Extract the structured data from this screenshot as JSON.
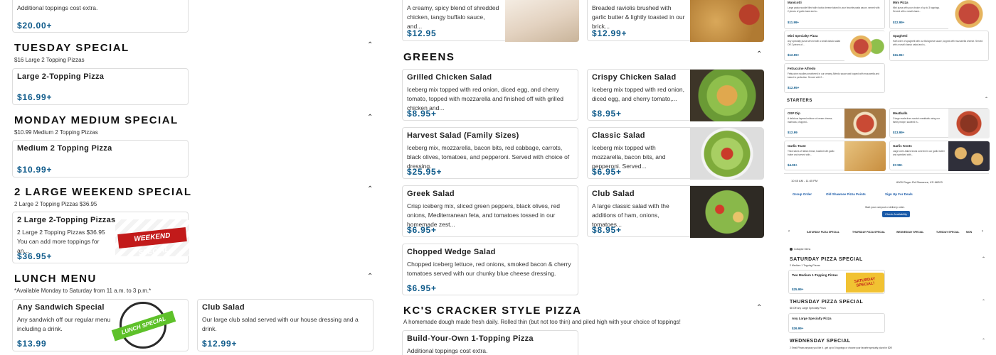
{
  "col1": {
    "top_card": {
      "desc": "Additional toppings cost extra.",
      "price": "$20.00+"
    },
    "tuesday": {
      "title": "TUESDAY SPECIAL",
      "subtitle": "$16 Large 2 Topping Pizzas",
      "item": {
        "name": "Large 2-Topping Pizza",
        "price": "$16.99+"
      }
    },
    "monday": {
      "title": "MONDAY MEDIUM SPECIAL",
      "subtitle": "$10.99 Medium 2 Topping Pizzas",
      "item": {
        "name": "Medium 2 Topping Pizza",
        "price": "$10.99+"
      }
    },
    "weekend": {
      "title": "2 LARGE WEEKEND SPECIAL",
      "subtitle": "2 Large 2 Topping Pizzas $36.95",
      "item": {
        "name": "2 Large 2-Topping Pizzas",
        "desc": "2 Large 2 Topping Pizzas $36.95 You can add more toppings for an...",
        "price": "$36.95+",
        "image_text": "WEEKEND SPECIAL"
      }
    },
    "lunch": {
      "title": "LUNCH MENU",
      "subtitle": "*Available Monday to Saturday from 11 a.m. to 3 p.m.*",
      "sandwich": {
        "name": "Any Sandwich Special",
        "desc": "Any sandwich off our regular menu including a drink.",
        "price": "$13.99",
        "image_text": "LUNCH SPECIAL"
      },
      "club": {
        "name": "Club Salad",
        "desc": "Our large club salad served with our house dressing and a drink.",
        "price": "$12.99+"
      }
    }
  },
  "col2": {
    "top_left": {
      "desc": "A creamy, spicy blend of shredded chicken, tangy buffalo sauce, and...",
      "price": "$12.95"
    },
    "top_right": {
      "desc": "Breaded raviolis brushed with garlic butter & lightly toasted in our brick...",
      "price": "$12.99+"
    },
    "greens_title": "GREENS",
    "salads": [
      {
        "name": "Grilled Chicken Salad",
        "desc": "Iceberg mix topped with red onion, diced egg, and cherry tomato, topped with mozzarella and finished off with grilled chicken and...",
        "price": "$8.95+"
      },
      {
        "name": "Crispy Chicken Salad",
        "desc": "Iceberg mix topped with red onion, diced egg, and cherry tomato,...",
        "price": "$8.95+"
      },
      {
        "name": "Harvest Salad (Family Sizes)",
        "desc": "Iceberg mix, mozzarella, bacon bits, red cabbage, carrots, black olives, tomatoes, and pepperoni. Served with choice of dressing.",
        "price": "$25.95+"
      },
      {
        "name": "Classic Salad",
        "desc": "Iceberg mix topped with mozzarella, bacon bits, and pepperoni. Served...",
        "price": "$6.95+"
      },
      {
        "name": "Greek Salad",
        "desc": "Crisp iceberg mix, sliced green peppers, black olives, red onions, Mediterranean feta, and tomatoes tossed in our homemade zest...",
        "price": "$6.95+"
      },
      {
        "name": "Club Salad",
        "desc": "A large classic salad with the additions of ham, onions, tomatoes...",
        "price": "$8.95+"
      },
      {
        "name": "Chopped Wedge Salad",
        "desc": "Chopped iceberg lettuce, red onions, smoked bacon & cherry tomatoes served with our chunky blue cheese dressing.",
        "price": "$6.95+"
      }
    ],
    "kc": {
      "title": "KC'S CRACKER STYLE PIZZA",
      "subtitle": "A homemade dough made fresh daily. Rolled thin (but not too thin) and piled high with your choice of toppings!",
      "item": {
        "name": "Build-Your-Own 1-Topping Pizza",
        "desc": "Additional toppings cost extra."
      }
    }
  },
  "col3": {
    "top_items": [
      {
        "name": "Manicotti",
        "desc": "Large pasta noodle filled with ricotta cheese baked in your favorite pasta sauce, served with 2 pieces of garlic toast and a...",
        "price": "$11.99+"
      },
      {
        "name": "Mini Pizza",
        "desc": "Mini pizza with your choice of up to 3 toppings. Served with a small classi...",
        "price": "$12.99+"
      },
      {
        "name": "Mini Specialty Pizza",
        "desc": "Any specialty pizza served with a small classic salad OR 2 pieces of...",
        "price": "$12.99+"
      },
      {
        "name": "Spaghetti",
        "desc": "Half order of spaghetti with our Bolognese sauce, topped with mozzarella cheese. Served with a small classic salad and a...",
        "price": "$11.95+"
      },
      {
        "name": "Fettuccine Alfredo",
        "desc": "Fettuccine noodles smothered in our creamy Alfredo sauce and topped with mozzarella and baked to perfection. Served with 2...",
        "price": "$12.95+"
      }
    ],
    "starters_title": "STARTERS",
    "starters": [
      {
        "name": "OSP Dip",
        "desc": "A delicious layered mixture of cream cheese, marinara, chopped...",
        "price": "$12.99"
      },
      {
        "name": "Meatballs",
        "desc": "3 large made-from-scratch meatballs using our family recipe, sautéed in...",
        "price": "$13.99+"
      },
      {
        "name": "Garlic Toast",
        "desc": "Thick slices of Italian bread, toasted with garlic butter and served with...",
        "price": "$4.99+"
      },
      {
        "name": "Garlic Knots",
        "desc": "Large oven-baked knots covered in our garlic butter and sprinkled with...",
        "price": "$7.99+"
      }
    ],
    "hours": "10:45 AM - 11:45 PM",
    "address": "6000 Roger Rd Shawnee, KS 66203",
    "nav": [
      "Group Order",
      "Old Shawnee Pizza Points",
      "Sign Up For Deals"
    ],
    "delivery_prompt": "Start your carryout or delivery order.",
    "check_btn": "Check Availability",
    "tabs": [
      "SATURDAY PIZZA SPECIAL",
      "THURSDAY PIZZA SPECIAL",
      "WEDNESDAY SPECIAL",
      "TUESDAY SPECIAL",
      "MON"
    ],
    "collapse": "Collapse Menu",
    "sat": {
      "title": "SATURDAY PIZZA SPECIAL",
      "sub": "2 Medium 1 Topping Pizzas",
      "item": "Two Medium 1-Topping Pizzas",
      "price": "$25.99+",
      "image_text": "SATURDAY SPECIAL!"
    },
    "thu": {
      "title": "THURSDAY PIZZA SPECIAL",
      "sub": "$8 Off any Large Specialty Pizza",
      "item": "Any Large Specialty Pizza",
      "price": "$26.99+"
    },
    "wed": {
      "title": "WEDNESDAY SPECIAL",
      "sub": "2 Small Pizzas anyway you like it - get up to 5 toppings or choose your favorite specialty pizza for $20!"
    }
  }
}
